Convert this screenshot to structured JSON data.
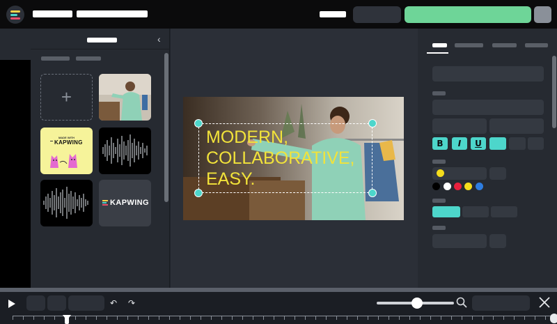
{
  "app": {
    "logo_bar_colors": [
      "#f8d24a",
      "#4dd6cb",
      "#e8506c"
    ]
  },
  "library": {
    "tiles": [
      {
        "kind": "add",
        "symbol": "+"
      },
      {
        "kind": "video-thumbnail"
      },
      {
        "kind": "image",
        "badge": "MADE WITH",
        "brand": "KAPWING"
      },
      {
        "kind": "audio-waveform"
      },
      {
        "kind": "audio-waveform"
      },
      {
        "kind": "logo",
        "brand": "KAPWING"
      }
    ]
  },
  "canvas": {
    "caption_lines": [
      "MODERN,",
      "COLLABORATIVE,",
      "EASY."
    ],
    "caption_color": "#f2e33a",
    "handle_color": "#4dd6cb"
  },
  "properties": {
    "format_buttons": [
      "B",
      "I",
      "U"
    ],
    "accent": "#4dd6cb",
    "selected_swatch": "#f5dd1c",
    "palette": [
      "#000000",
      "#ffffff",
      "#e8203d",
      "#f5dd1c",
      "#2e7de0"
    ]
  },
  "toolbar": {
    "undo_icon": "undo-icon",
    "redo_icon": "redo-icon",
    "undo_glyph": "↶",
    "redo_glyph": "↷"
  },
  "theme": {
    "topbar": "#0b0b0c",
    "panel": "#262a31",
    "stage": "#2b2f37",
    "primary_button": "#6ed598"
  }
}
